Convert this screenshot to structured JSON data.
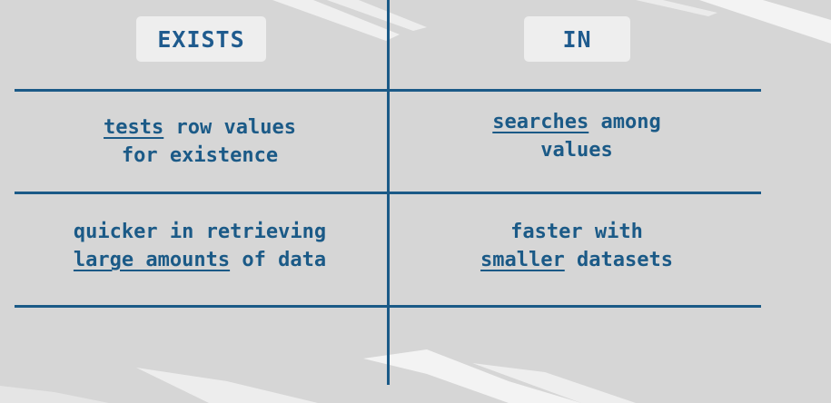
{
  "headers": {
    "left": "EXISTS",
    "right": "IN"
  },
  "rows": [
    {
      "left": {
        "line1_underlined": "tests",
        "line1_rest": " row values",
        "line2": "for existence"
      },
      "right": {
        "line1_underlined": "searches",
        "line1_rest": " among",
        "line2": "values"
      }
    },
    {
      "left": {
        "line1": "quicker in retrieving",
        "line2_underlined": "large amounts",
        "line2_rest": " of data"
      },
      "right": {
        "line1": "faster with",
        "line2_underlined": "smaller",
        "line2_rest": " datasets"
      }
    }
  ],
  "colors": {
    "background": "#d6d6d6",
    "accent": "#1b5a87",
    "header_box": "#eeeeee"
  }
}
